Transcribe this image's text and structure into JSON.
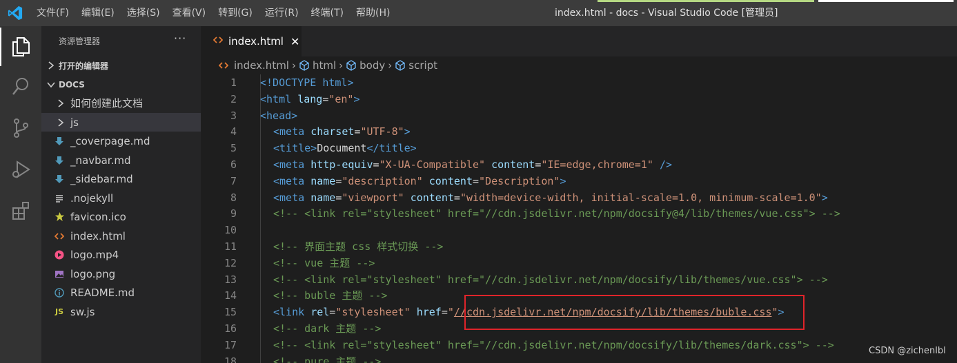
{
  "window": {
    "title": "index.html - docs - Visual Studio Code [管理员]",
    "menu": [
      "文件(F)",
      "编辑(E)",
      "选择(S)",
      "查看(V)",
      "转到(G)",
      "运行(R)",
      "终端(T)",
      "帮助(H)"
    ]
  },
  "activity_bar": {
    "icons": [
      "explorer-icon",
      "search-icon",
      "source-control-icon",
      "run-debug-icon",
      "extensions-icon"
    ],
    "active": "explorer-icon"
  },
  "sidebar": {
    "title": "资源管理器",
    "more": "···",
    "open_editors": "打开的编辑器",
    "folder": "DOCS",
    "items": [
      {
        "label": "如何创建此文档",
        "kind": "folder"
      },
      {
        "label": "js",
        "kind": "folder",
        "selected": true
      },
      {
        "label": "_coverpage.md",
        "kind": "markdown-icon"
      },
      {
        "label": "_navbar.md",
        "kind": "markdown-icon"
      },
      {
        "label": "_sidebar.md",
        "kind": "markdown-icon"
      },
      {
        "label": ".nojekyll",
        "kind": "text-file-icon"
      },
      {
        "label": "favicon.ico",
        "kind": "star-icon"
      },
      {
        "label": "index.html",
        "kind": "html-icon"
      },
      {
        "label": "logo.mp4",
        "kind": "video-icon"
      },
      {
        "label": "logo.png",
        "kind": "image-icon"
      },
      {
        "label": "README.md",
        "kind": "info-icon"
      },
      {
        "label": "sw.js",
        "kind": "js-icon"
      }
    ]
  },
  "tabs": [
    {
      "label": "index.html",
      "active": true,
      "close": "✕"
    }
  ],
  "breadcrumb": [
    "index.html",
    "html",
    "body",
    "script"
  ],
  "editor": {
    "lines": [
      {
        "n": "1",
        "indent": 0,
        "tokens": [
          [
            "tag",
            "<!DOCTYPE "
          ],
          [
            "tag",
            "html"
          ],
          [
            "tag",
            ">"
          ]
        ]
      },
      {
        "n": "2",
        "indent": 0,
        "tokens": [
          [
            "tag",
            "<html "
          ],
          [
            "attr",
            "lang"
          ],
          [
            "txt",
            "="
          ],
          [
            "str",
            "\"en\""
          ],
          [
            "tag",
            ">"
          ]
        ]
      },
      {
        "n": "3",
        "indent": 0,
        "tokens": [
          [
            "tag",
            "<head>"
          ]
        ]
      },
      {
        "n": "4",
        "indent": 1,
        "tokens": [
          [
            "tag",
            "<meta "
          ],
          [
            "attr",
            "charset"
          ],
          [
            "txt",
            "="
          ],
          [
            "str",
            "\"UTF-8\""
          ],
          [
            "tag",
            ">"
          ]
        ]
      },
      {
        "n": "5",
        "indent": 1,
        "tokens": [
          [
            "tag",
            "<title>"
          ],
          [
            "txt",
            "Document"
          ],
          [
            "tag",
            "</title>"
          ]
        ]
      },
      {
        "n": "6",
        "indent": 1,
        "tokens": [
          [
            "tag",
            "<meta "
          ],
          [
            "attr",
            "http-equiv"
          ],
          [
            "txt",
            "="
          ],
          [
            "str",
            "\"X-UA-Compatible\""
          ],
          [
            "txt",
            " "
          ],
          [
            "attr",
            "content"
          ],
          [
            "txt",
            "="
          ],
          [
            "str",
            "\"IE=edge,chrome=1\""
          ],
          [
            "txt",
            " "
          ],
          [
            "tag",
            "/>"
          ]
        ]
      },
      {
        "n": "7",
        "indent": 1,
        "tokens": [
          [
            "tag",
            "<meta "
          ],
          [
            "attr",
            "name"
          ],
          [
            "txt",
            "="
          ],
          [
            "str",
            "\"description\""
          ],
          [
            "txt",
            " "
          ],
          [
            "attr",
            "content"
          ],
          [
            "txt",
            "="
          ],
          [
            "str",
            "\"Description\""
          ],
          [
            "tag",
            ">"
          ]
        ]
      },
      {
        "n": "8",
        "indent": 1,
        "tokens": [
          [
            "tag",
            "<meta "
          ],
          [
            "attr",
            "name"
          ],
          [
            "txt",
            "="
          ],
          [
            "str",
            "\"viewport\""
          ],
          [
            "txt",
            " "
          ],
          [
            "attr",
            "content"
          ],
          [
            "txt",
            "="
          ],
          [
            "str",
            "\"width=device-width, initial-scale=1.0, minimum-scale=1.0\""
          ],
          [
            "tag",
            ">"
          ]
        ]
      },
      {
        "n": "9",
        "indent": 1,
        "tokens": [
          [
            "cmt",
            "<!-- <link rel=\"stylesheet\" href=\"//cdn.jsdelivr.net/npm/docsify@4/lib/themes/vue.css\"> -->"
          ]
        ]
      },
      {
        "n": "10",
        "indent": 0,
        "tokens": []
      },
      {
        "n": "11",
        "indent": 1,
        "tokens": [
          [
            "cmt",
            "<!-- 界面主题 css 样式切换 -->"
          ]
        ]
      },
      {
        "n": "12",
        "indent": 1,
        "tokens": [
          [
            "cmt",
            "<!-- vue 主题 -->"
          ]
        ]
      },
      {
        "n": "13",
        "indent": 1,
        "tokens": [
          [
            "cmt",
            "<!-- <link rel=\"stylesheet\" href=\"//cdn.jsdelivr.net/npm/docsify/lib/themes/vue.css\"> -->"
          ]
        ]
      },
      {
        "n": "14",
        "indent": 1,
        "tokens": [
          [
            "cmt",
            "<!-- buble 主题 -->"
          ]
        ]
      },
      {
        "n": "15",
        "indent": 1,
        "tokens": [
          [
            "tag",
            "<link "
          ],
          [
            "attr",
            "rel"
          ],
          [
            "txt",
            "="
          ],
          [
            "str",
            "\"stylesheet\""
          ],
          [
            "txt",
            " "
          ],
          [
            "attr",
            "href"
          ],
          [
            "txt",
            "="
          ],
          [
            "str",
            "\""
          ],
          [
            "strlink",
            "//cdn.jsdelivr.net/npm/docsify/lib/themes/buble.css"
          ],
          [
            "str",
            "\""
          ],
          [
            "tag",
            ">"
          ]
        ]
      },
      {
        "n": "16",
        "indent": 1,
        "tokens": [
          [
            "cmt",
            "<!-- dark 主题 -->"
          ]
        ]
      },
      {
        "n": "17",
        "indent": 1,
        "tokens": [
          [
            "cmt",
            "<!-- <link rel=\"stylesheet\" href=\"//cdn.jsdelivr.net/npm/docsify/lib/themes/dark.css\"> -->"
          ]
        ]
      },
      {
        "n": "18",
        "indent": 1,
        "tokens": [
          [
            "cmt",
            "<!-- pure 主题 -->"
          ]
        ]
      }
    ]
  },
  "watermark": "CSDN @zichenlbl"
}
